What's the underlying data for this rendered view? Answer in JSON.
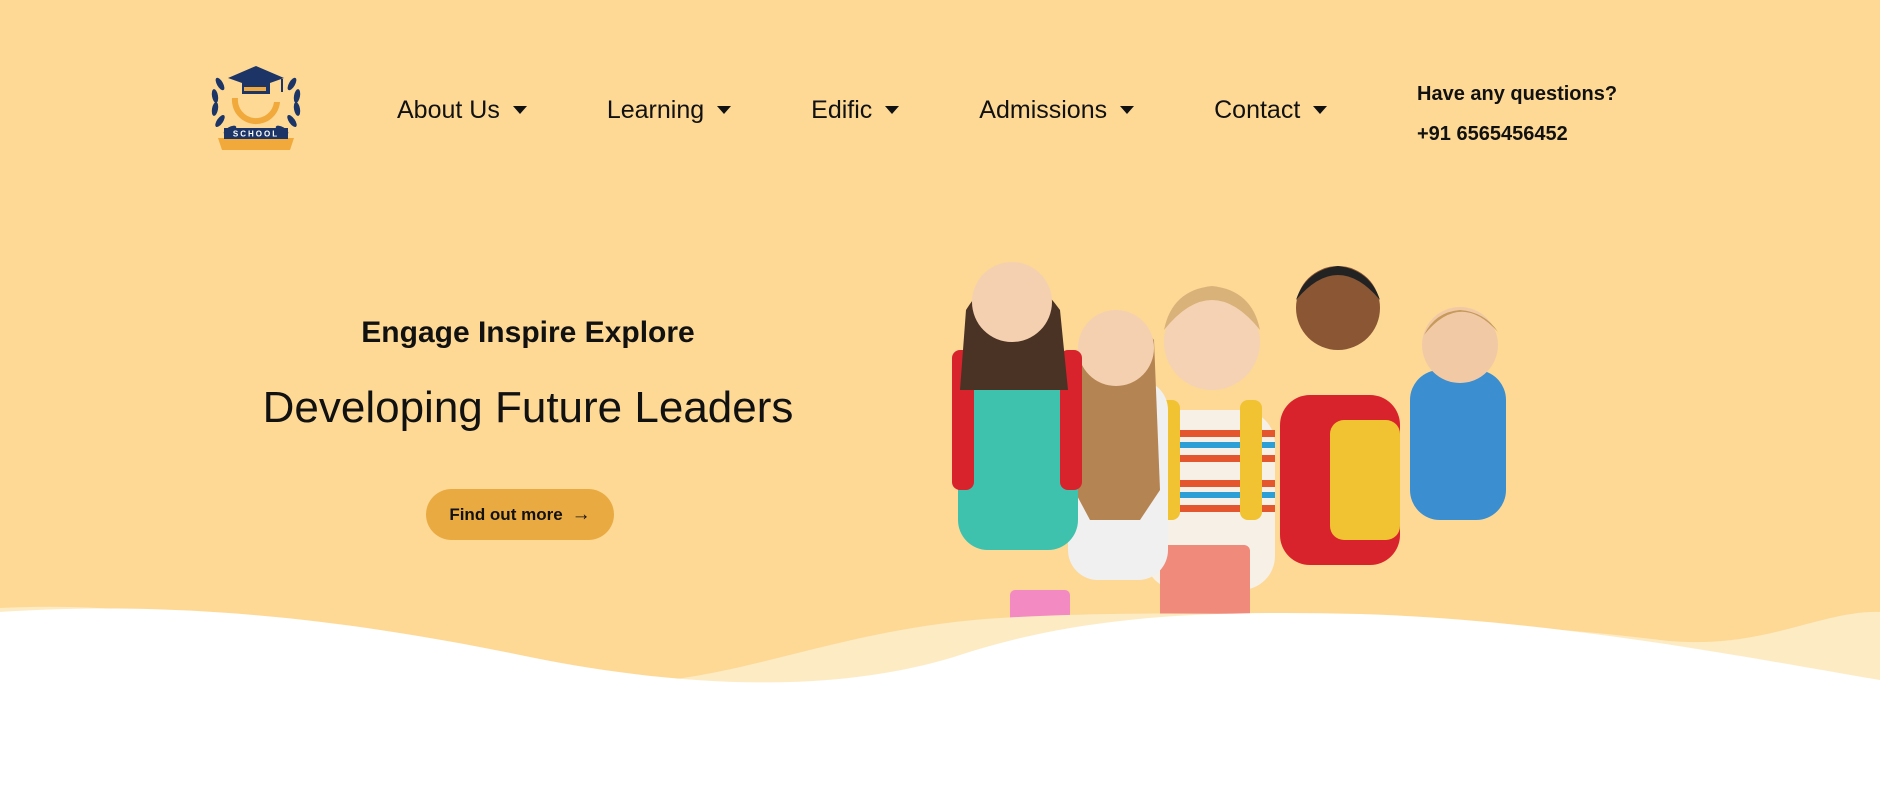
{
  "header": {
    "logo_text": "SCHOOL",
    "nav": [
      {
        "label": "About Us"
      },
      {
        "label": "Learning"
      },
      {
        "label": "Edific"
      },
      {
        "label": "Admissions"
      },
      {
        "label": "Contact"
      }
    ],
    "contact": {
      "question": "Have any questions?",
      "phone": "+91 6565456452"
    }
  },
  "hero": {
    "tagline": "Engage Inspire Explore",
    "headline": "Developing Future Leaders",
    "cta_label": "Find out more",
    "cta_icon": "arrow-right-icon",
    "image_subject": "group of five smiling schoolchildren with backpacks and books"
  },
  "colors": {
    "background": "#fdd995",
    "accent": "#eaaa42",
    "logo_navy": "#1c3566",
    "logo_orange": "#f0a93a",
    "text": "#111111"
  }
}
